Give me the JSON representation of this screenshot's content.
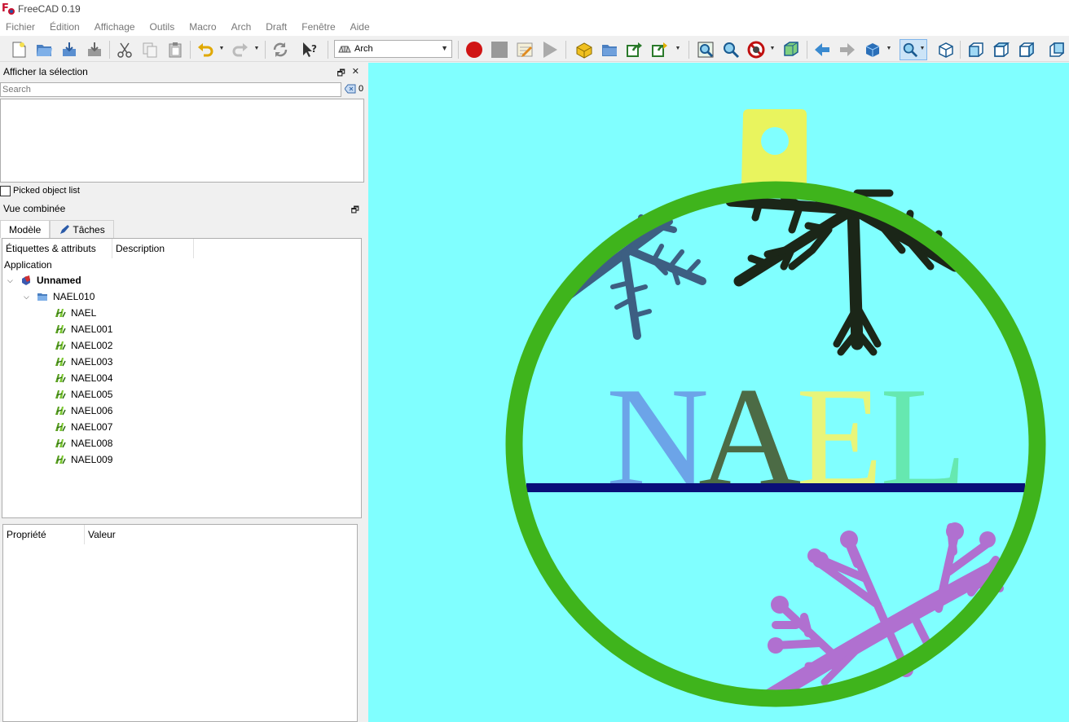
{
  "window": {
    "title": "FreeCAD 0.19"
  },
  "menu": [
    "Fichier",
    "Édition",
    "Affichage",
    "Outils",
    "Macro",
    "Arch",
    "Draft",
    "Fenêtre",
    "Aide"
  ],
  "toolbar": {
    "workbench": "Arch"
  },
  "selection_panel": {
    "title": "Afficher la sélection",
    "search_placeholder": "Search",
    "count": "0",
    "picked_label": "Picked object list"
  },
  "combo_view": {
    "title": "Vue combinée",
    "tabs": [
      "Modèle",
      "Tâches"
    ],
    "columns": [
      "Étiquettes & attributs",
      "Description"
    ],
    "tree": {
      "root": "Application",
      "document": "Unnamed",
      "group": "NAEL010",
      "items": [
        "NAEL",
        "NAEL001",
        "NAEL002",
        "NAEL003",
        "NAEL004",
        "NAEL005",
        "NAEL006",
        "NAEL007",
        "NAEL008",
        "NAEL009"
      ]
    }
  },
  "property_panel": {
    "columns": [
      "Propriété",
      "Valeur"
    ]
  },
  "scene": {
    "text": "NAEL",
    "colors": {
      "background": "#80ffff",
      "ring": "#3fb41c",
      "tab": "#e9f45e",
      "line": "#0a0f78",
      "letter_n": "#6ca4e8",
      "letter_a": "#4c6b45",
      "letter_e": "#e8f57a",
      "letter_l": "#66e8b0",
      "flake_top_left": "#3d5f82",
      "flake_top_right": "#1b2618",
      "flake_bottom": "#b070d0"
    }
  }
}
